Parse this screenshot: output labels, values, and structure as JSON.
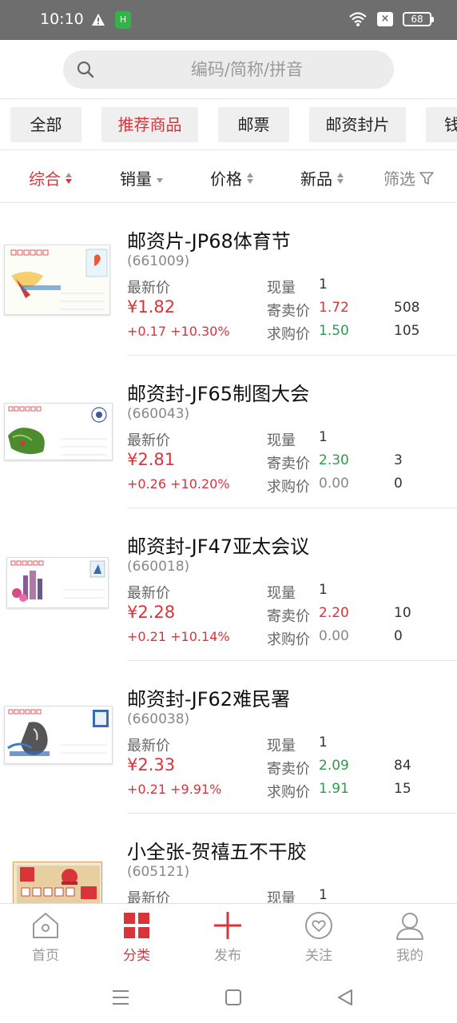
{
  "status_bar": {
    "time": "10:10",
    "app_badge": "H",
    "close_badge": "×",
    "battery": "68"
  },
  "search": {
    "placeholder": "编码/简称/拼音"
  },
  "categories": [
    {
      "label": "全部",
      "active": false
    },
    {
      "label": "推荐商品",
      "active": true
    },
    {
      "label": "邮票",
      "active": false
    },
    {
      "label": "邮资封片",
      "active": false
    },
    {
      "label": "钱",
      "active": false
    }
  ],
  "sort": {
    "comprehensive": "综合",
    "sales": "销量",
    "price": "价格",
    "new": "新品",
    "filter": "筛选"
  },
  "labels": {
    "latest": "最新价",
    "stock": "现量",
    "sell": "寄卖价",
    "buy": "求购价"
  },
  "products": [
    {
      "title": "邮资片-JP68体育节",
      "code": "(661009)",
      "price": "¥1.82",
      "change": "+0.17  +10.30%",
      "stock": "1",
      "sell_price": "1.72",
      "sell_qty": "508",
      "buy_price": "1.50",
      "buy_qty": "105"
    },
    {
      "title": "邮资封-JF65制图大会",
      "code": "(660043)",
      "price": "¥2.81",
      "change": "+0.26  +10.20%",
      "stock": "1",
      "sell_price": "2.30",
      "sell_qty": "3",
      "buy_price": "0.00",
      "buy_qty": "0"
    },
    {
      "title": "邮资封-JF47亚太会议",
      "code": "(660018)",
      "price": "¥2.28",
      "change": "+0.21  +10.14%",
      "stock": "1",
      "sell_price": "2.20",
      "sell_qty": "10",
      "buy_price": "0.00",
      "buy_qty": "0"
    },
    {
      "title": "邮资封-JF62难民署",
      "code": "(660038)",
      "price": "¥2.33",
      "change": "+0.21  +9.91%",
      "stock": "1",
      "sell_price": "2.09",
      "sell_qty": "84",
      "buy_price": "1.91",
      "buy_qty": "15"
    },
    {
      "title": "小全张-贺禧五不干胶",
      "code": "(605121)",
      "price": "",
      "change": "",
      "stock": "1",
      "sell_price": "",
      "sell_qty": "",
      "buy_price": "",
      "buy_qty": ""
    }
  ],
  "tabs": [
    {
      "label": "首页",
      "icon": "home-icon",
      "active": false
    },
    {
      "label": "分类",
      "icon": "category-icon",
      "active": true
    },
    {
      "label": "发布",
      "icon": "publish-plus-icon",
      "active": false
    },
    {
      "label": "关注",
      "icon": "heart-icon",
      "active": false
    },
    {
      "label": "我的",
      "icon": "profile-icon",
      "active": false
    }
  ],
  "colors": {
    "accent": "#d9343a",
    "green": "#2f9b4a",
    "status_bar": "#6e6e6e"
  }
}
